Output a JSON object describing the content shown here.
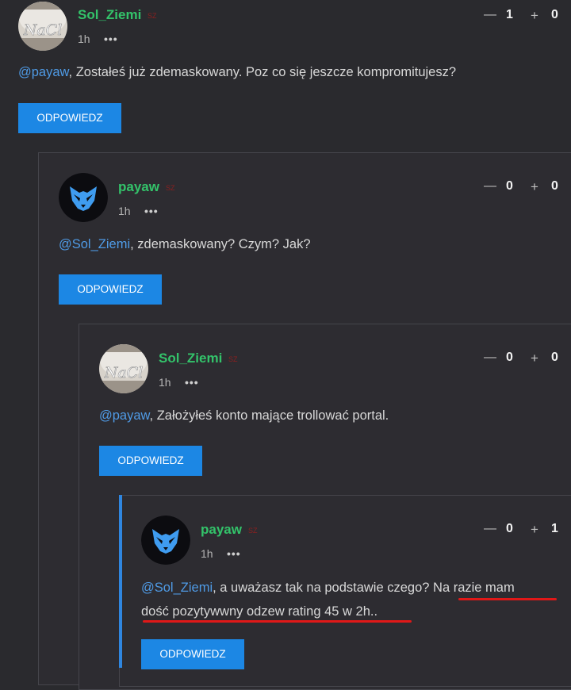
{
  "comments": [
    {
      "username": "Sol_Ziemi",
      "tag": "SZ",
      "time": "1h",
      "votes_down": "1",
      "votes_up": "0",
      "mention": "@payaw",
      "body": ", Zostałeś już zdemaskowany. Poz co się jeszcze kompromitujesz?",
      "reply_label": "ODPOWIEDZ",
      "avatar": "salt-jar-avatar"
    },
    {
      "username": "payaw",
      "tag": "SZ",
      "time": "1h",
      "votes_down": "0",
      "votes_up": "0",
      "mention": "@Sol_Ziemi",
      "body": ", zdemaskowany? Czym? Jak?",
      "reply_label": "ODPOWIEDZ",
      "avatar": "wolf-logo-avatar"
    },
    {
      "username": "Sol_Ziemi",
      "tag": "SZ",
      "time": "1h",
      "votes_down": "0",
      "votes_up": "0",
      "mention": "@payaw",
      "body": ", Założyłeś konto mające trollować portal.",
      "reply_label": "ODPOWIEDZ",
      "avatar": "salt-jar-avatar"
    },
    {
      "username": "payaw",
      "tag": "SZ",
      "time": "1h",
      "votes_down": "0",
      "votes_up": "1",
      "mention": "@Sol_Ziemi",
      "body_line1": ", a uważasz tak na podstawie czego? Na razie mam",
      "body_line2": "dość pozytywwny odzew rating 45 w 2h..",
      "reply_label": "ODPOWIEDZ",
      "avatar": "wolf-logo-avatar"
    }
  ],
  "icons": {
    "more": "•••",
    "minus": "—",
    "plus": "+"
  },
  "colors": {
    "background": "#2a2a2e",
    "username": "#33c36a",
    "mention": "#4f9be6",
    "button": "#1c87e4",
    "underline": "#e01818",
    "accent_border": "#2f86df"
  },
  "avatar_text": "NaCl"
}
